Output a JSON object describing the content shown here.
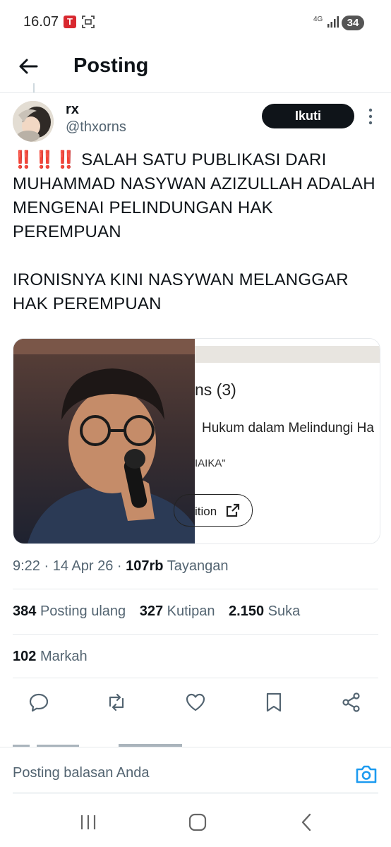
{
  "status_bar": {
    "time": "16.07",
    "network": "4G",
    "battery": "34",
    "app_icon_glyph": "T"
  },
  "header": {
    "title": "Posting",
    "back_icon": "arrow-left-icon"
  },
  "author": {
    "display_name": "rx",
    "username": "@thxorns",
    "follow_label": "Ikuti"
  },
  "tweet": {
    "emoji": "‼️‼️‼️",
    "paragraph1": " SALAH SATU PUBLIKASI DARI MUHAMMAD NASYWAN AZIZULLAH ADALAH MENGENAI PELINDUNGAN HAK PEREMPUAN",
    "paragraph2": "IRONISNYA KINI NASYWAN MELANGGAR HAK PEREMPUAN"
  },
  "media": {
    "screenshot_heading": "ns (3)",
    "screenshot_line": "Hukum dalam Melindungi Ha",
    "screenshot_quote": "IAIKA\"",
    "screenshot_button": "ition"
  },
  "meta": {
    "time": "9:22",
    "date": "14 Apr 26",
    "views_count": "107rb",
    "views_label": "Tayangan"
  },
  "stats": {
    "reposts_count": "384",
    "reposts_label": "Posting ulang",
    "quotes_count": "327",
    "quotes_label": "Kutipan",
    "likes_count": "2.150",
    "likes_label": "Suka",
    "bookmarks_count": "102",
    "bookmarks_label": "Markah"
  },
  "actions": [
    "reply-icon",
    "repost-icon",
    "like-icon",
    "bookmark-icon",
    "share-icon"
  ],
  "reply": {
    "placeholder": "Posting balasan Anda"
  },
  "colors": {
    "text": "#0f1419",
    "secondary": "#536471",
    "accent": "#1d9bf0",
    "divider": "#e6e9ec"
  }
}
